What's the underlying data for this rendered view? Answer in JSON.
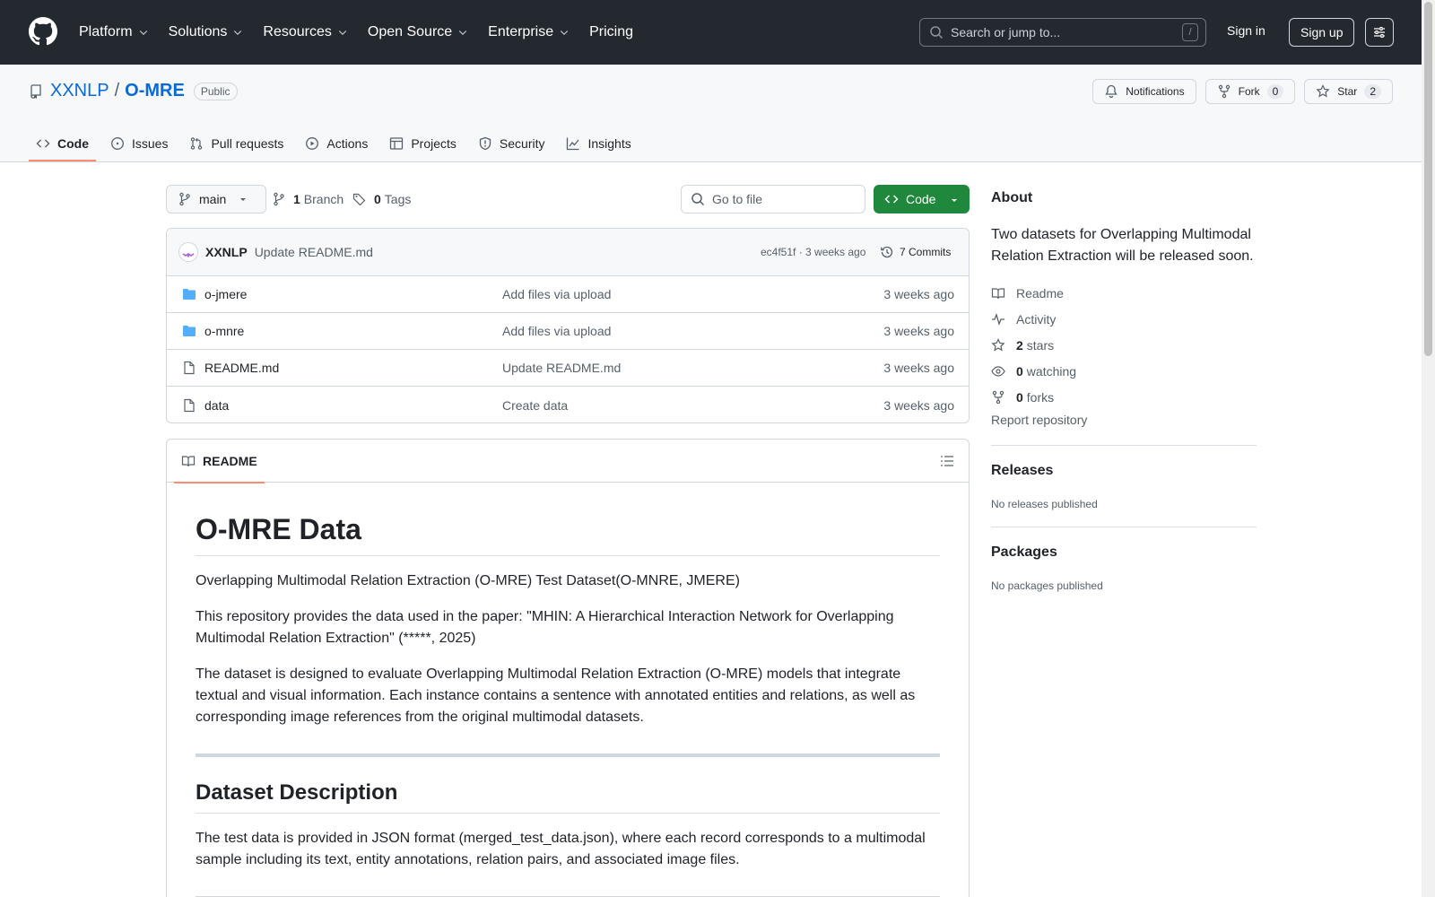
{
  "header": {
    "nav": [
      {
        "label": "Platform",
        "dropdown": true
      },
      {
        "label": "Solutions",
        "dropdown": true
      },
      {
        "label": "Resources",
        "dropdown": true
      },
      {
        "label": "Open Source",
        "dropdown": true
      },
      {
        "label": "Enterprise",
        "dropdown": true
      },
      {
        "label": "Pricing",
        "dropdown": false
      }
    ],
    "search_placeholder": "Search or jump to...",
    "search_shortcut": "/",
    "sign_in": "Sign in",
    "sign_up": "Sign up"
  },
  "repo": {
    "owner": "XXNLP",
    "separator": "/",
    "name": "O-MRE",
    "visibility": "Public",
    "actions": {
      "notifications": "Notifications",
      "fork": "Fork",
      "fork_count": "0",
      "star": "Star",
      "star_count": "2"
    },
    "tabs": [
      {
        "label": "Code",
        "icon": "code-icon",
        "active": true
      },
      {
        "label": "Issues",
        "icon": "issue-icon",
        "active": false
      },
      {
        "label": "Pull requests",
        "icon": "pull-request-icon",
        "active": false
      },
      {
        "label": "Actions",
        "icon": "play-icon",
        "active": false
      },
      {
        "label": "Projects",
        "icon": "table-icon",
        "active": false
      },
      {
        "label": "Security",
        "icon": "shield-icon",
        "active": false
      },
      {
        "label": "Insights",
        "icon": "graph-icon",
        "active": false
      }
    ]
  },
  "filenav": {
    "branch": "main",
    "branch_count": "1",
    "branch_label": "Branch",
    "tag_count": "0",
    "tag_label": "Tags",
    "goto_placeholder": "Go to file",
    "code_button": "Code"
  },
  "commit": {
    "author": "XXNLP",
    "message": "Update README.md",
    "hash_time": "ec4f51f · 3 weeks ago",
    "count_label": "7 Commits"
  },
  "files": [
    {
      "name": "o-jmere",
      "type": "folder",
      "message": "Add files via upload",
      "date": "3 weeks ago"
    },
    {
      "name": "o-mnre",
      "type": "folder",
      "message": "Add files via upload",
      "date": "3 weeks ago"
    },
    {
      "name": "README.md",
      "type": "file",
      "message": "Update README.md",
      "date": "3 weeks ago"
    },
    {
      "name": "data",
      "type": "file",
      "message": "Create data",
      "date": "3 weeks ago"
    }
  ],
  "readme": {
    "tab_label": "README",
    "h1": "O-MRE Data",
    "p1": "Overlapping Multimodal Relation Extraction (O-MRE) Test Dataset(O-MNRE, JMERE)",
    "p2": "This repository provides the data used in the paper: \"MHIN: A Hierarchical Interaction Network for Overlapping Multimodal Relation Extraction\" (*****, 2025)",
    "p3": "The dataset is designed to evaluate Overlapping Multimodal Relation Extraction (O-MRE) models that integrate textual and visual information. Each instance contains a sentence with annotated entities and relations, as well as corresponding image references from the original multimodal datasets.",
    "h2": "Dataset Description",
    "p4": "The test data is provided in JSON format (merged_test_data.json), where each record corresponds to a multimodal sample including its text, entity annotations, relation pairs, and associated image files."
  },
  "sidebar": {
    "about_title": "About",
    "description": "Two datasets for Overlapping Multimodal Relation Extraction will be released soon.",
    "readme": "Readme",
    "activity": "Activity",
    "stars_count": "2",
    "stars_label": "stars",
    "watching_count": "0",
    "watching_label": "watching",
    "forks_count": "0",
    "forks_label": "forks",
    "report": "Report repository",
    "releases_title": "Releases",
    "releases_empty": "No releases published",
    "packages_title": "Packages",
    "packages_empty": "No packages published"
  }
}
